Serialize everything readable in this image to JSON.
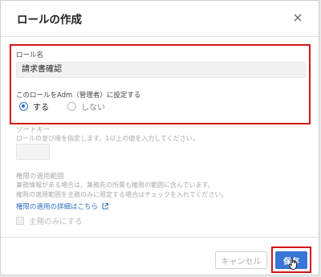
{
  "dialog": {
    "title": "ロールの作成",
    "close_icon": "close-icon"
  },
  "role_name": {
    "label": "ロール名",
    "value": "請求書確認"
  },
  "admin_setting": {
    "label": "このロールをAdm（管理者）に設定する",
    "options": [
      {
        "label": "する",
        "selected": true
      },
      {
        "label": "しない",
        "selected": false
      }
    ]
  },
  "sort_key": {
    "label": "ソートキー",
    "help": "ロールの並び順を指定します。1以上の値を入力してください。",
    "value": ""
  },
  "scope": {
    "label": "権限の適用範囲",
    "help_line1": "兼務情報がある場合は、兼務先の所属も権限の範囲に含んでいます。",
    "help_line2": "権限の適用範囲を主務のみに限定する場合はチェックを入れてください。",
    "link_text": "権限の適用の詳細はこちら",
    "link_icon": "external-link-icon",
    "checkbox_label": "主務のみにする",
    "checkbox_checked": false
  },
  "footer": {
    "cancel_label": "キャンセル",
    "save_label": "保存"
  },
  "colors": {
    "accent": "#3875d7",
    "highlight": "#d4141c",
    "link": "#2e6fbf"
  }
}
